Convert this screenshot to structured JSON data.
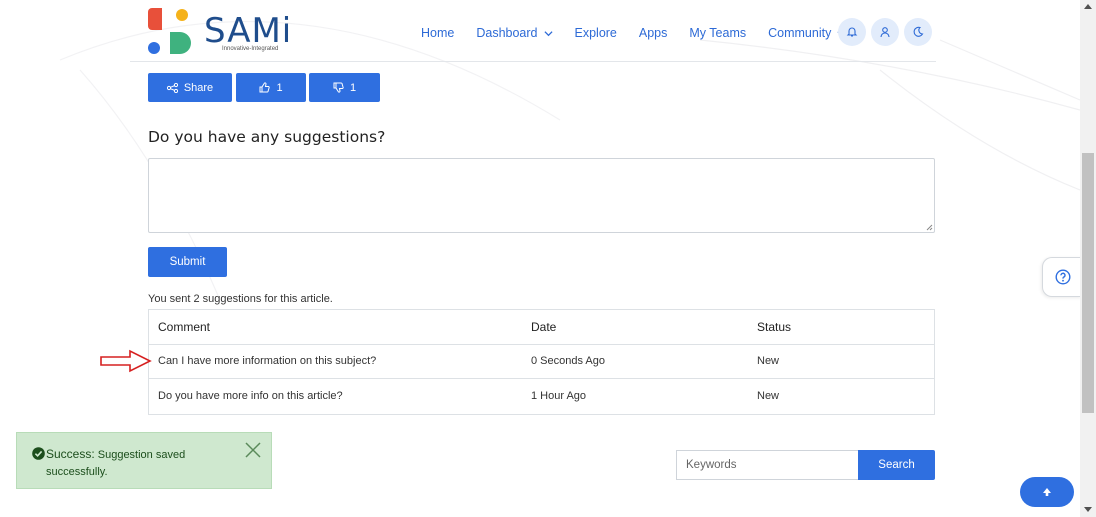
{
  "logo": {
    "name": "SAMi",
    "tagline": "Innovative-Integrated"
  },
  "nav": {
    "items": [
      {
        "label": "Home"
      },
      {
        "label": "Dashboard",
        "dropdown": true
      },
      {
        "label": "Explore"
      },
      {
        "label": "Apps"
      },
      {
        "label": "My Teams"
      },
      {
        "label": "Community",
        "dropdown": true
      }
    ],
    "icons": [
      "bell-icon",
      "user-icon",
      "moon-icon"
    ]
  },
  "actions": {
    "share_label": "Share",
    "like_count": "1",
    "dislike_count": "1"
  },
  "suggestions": {
    "title": "Do you have any suggestions?",
    "input_value": "",
    "submit_label": "Submit",
    "sent_note": "You sent 2 suggestions for this article.",
    "table": {
      "headers": {
        "comment": "Comment",
        "date": "Date",
        "status": "Status"
      },
      "rows": [
        {
          "comment": "Can I have more information on this subject?",
          "date": "0 Seconds Ago",
          "status": "New"
        },
        {
          "comment": "Do you have more info on this article?",
          "date": "1 Hour Ago",
          "status": "New"
        }
      ]
    }
  },
  "toast": {
    "label": "Success:",
    "message": "Suggestion saved successfully."
  },
  "search": {
    "placeholder": "Keywords",
    "button_label": "Search"
  },
  "colors": {
    "primary": "#2f6fe0",
    "nav_link": "#2d6ad6",
    "toast_bg": "#cfe8cf",
    "arrow": "#d62020"
  }
}
